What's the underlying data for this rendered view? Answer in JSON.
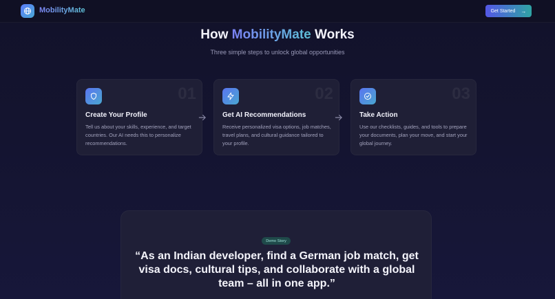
{
  "header": {
    "brand": "MobilityMate",
    "cta_label": "Get Started"
  },
  "section": {
    "title_prefix": "How ",
    "title_accent": "MobilityMate",
    "title_suffix": " Works",
    "subtitle": "Three simple steps to unlock global opportunities"
  },
  "steps": [
    {
      "number": "01",
      "title": "Create Your Profile",
      "description": "Tell us about your skills, experience, and target countries. Our AI needs this to personalize recommendations.",
      "icon": "shield-icon"
    },
    {
      "number": "02",
      "title": "Get AI Recommendations",
      "description": "Receive personalized visa options, job matches, travel plans, and cultural guidance tailored to your profile.",
      "icon": "lightning-icon"
    },
    {
      "number": "03",
      "title": "Take Action",
      "description": "Use our checklists, guides, and tools to prepare your documents, plan your move, and start your global journey.",
      "icon": "check-circle-icon"
    }
  ],
  "story": {
    "badge": "Demo Story",
    "quote": "“As an Indian developer, find a German job match, get visa docs, cultural tips, and collaborate with a global team – all in one app.”"
  },
  "colors": {
    "background": "#13132a",
    "card": "#1f1f36",
    "accent_start": "#5b7cfa",
    "accent_end": "#4aa9d6"
  }
}
